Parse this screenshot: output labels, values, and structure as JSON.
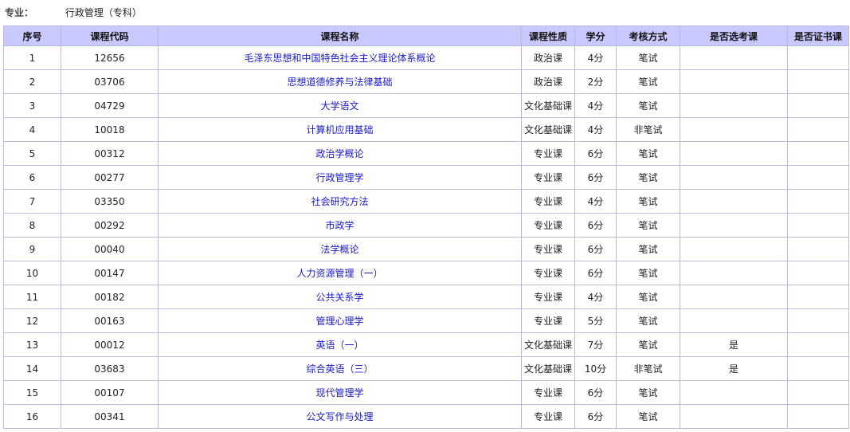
{
  "major": {
    "label": "专业：",
    "value": "行政管理（专科）"
  },
  "table": {
    "headers": [
      "序号",
      "课程代码",
      "课程名称",
      "课程性质",
      "学分",
      "考核方式",
      "是否选考课",
      "是否证书课"
    ],
    "rows": [
      {
        "no": "1",
        "code": "12656",
        "name": "毛泽东思想和中国特色社会主义理论体系概论",
        "type": "政治课",
        "credit": "4分",
        "exam": "笔试",
        "elective": "",
        "certificate": ""
      },
      {
        "no": "2",
        "code": "03706",
        "name": "思想道德修养与法律基础",
        "type": "政治课",
        "credit": "2分",
        "exam": "笔试",
        "elective": "",
        "certificate": ""
      },
      {
        "no": "3",
        "code": "04729",
        "name": "大学语文",
        "type": "文化基础课",
        "credit": "4分",
        "exam": "笔试",
        "elective": "",
        "certificate": ""
      },
      {
        "no": "4",
        "code": "10018",
        "name": "计算机应用基础",
        "type": "文化基础课",
        "credit": "4分",
        "exam": "非笔试",
        "elective": "",
        "certificate": ""
      },
      {
        "no": "5",
        "code": "00312",
        "name": "政治学概论",
        "type": "专业课",
        "credit": "6分",
        "exam": "笔试",
        "elective": "",
        "certificate": ""
      },
      {
        "no": "6",
        "code": "00277",
        "name": "行政管理学",
        "type": "专业课",
        "credit": "6分",
        "exam": "笔试",
        "elective": "",
        "certificate": ""
      },
      {
        "no": "7",
        "code": "03350",
        "name": "社会研究方法",
        "type": "专业课",
        "credit": "4分",
        "exam": "笔试",
        "elective": "",
        "certificate": ""
      },
      {
        "no": "8",
        "code": "00292",
        "name": "市政学",
        "type": "专业课",
        "credit": "6分",
        "exam": "笔试",
        "elective": "",
        "certificate": ""
      },
      {
        "no": "9",
        "code": "00040",
        "name": "法学概论",
        "type": "专业课",
        "credit": "6分",
        "exam": "笔试",
        "elective": "",
        "certificate": ""
      },
      {
        "no": "10",
        "code": "00147",
        "name": "人力资源管理（一）",
        "type": "专业课",
        "credit": "6分",
        "exam": "笔试",
        "elective": "",
        "certificate": ""
      },
      {
        "no": "11",
        "code": "00182",
        "name": "公共关系学",
        "type": "专业课",
        "credit": "4分",
        "exam": "笔试",
        "elective": "",
        "certificate": ""
      },
      {
        "no": "12",
        "code": "00163",
        "name": "管理心理学",
        "type": "专业课",
        "credit": "5分",
        "exam": "笔试",
        "elective": "",
        "certificate": ""
      },
      {
        "no": "13",
        "code": "00012",
        "name": "英语（一）",
        "type": "文化基础课",
        "credit": "7分",
        "exam": "笔试",
        "elective": "是",
        "certificate": ""
      },
      {
        "no": "14",
        "code": "03683",
        "name": "综合英语（三）",
        "type": "文化基础课",
        "credit": "10分",
        "exam": "非笔试",
        "elective": "是",
        "certificate": ""
      },
      {
        "no": "15",
        "code": "00107",
        "name": "现代管理学",
        "type": "专业课",
        "credit": "6分",
        "exam": "笔试",
        "elective": "",
        "certificate": ""
      },
      {
        "no": "16",
        "code": "00341",
        "name": "公文写作与处理",
        "type": "专业课",
        "credit": "6分",
        "exam": "笔试",
        "elective": "",
        "certificate": ""
      }
    ]
  },
  "colors": {
    "header_bg": "#c9c9ff",
    "border": "#b9b9d9",
    "link": "#1a1ac8"
  }
}
